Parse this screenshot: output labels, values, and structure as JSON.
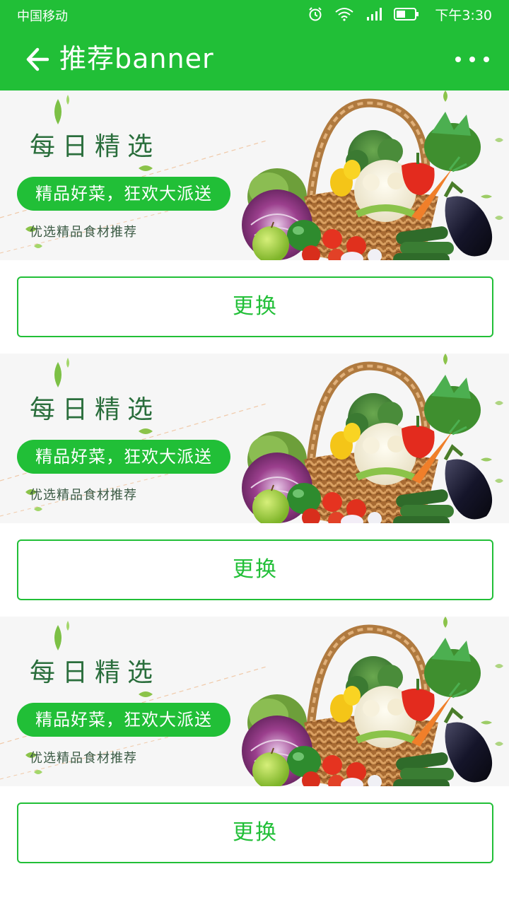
{
  "status_bar": {
    "carrier": "中国移动",
    "time": "下午3:30",
    "icons": [
      "alarm-icon",
      "wifi-icon",
      "signal-icon",
      "battery-icon"
    ]
  },
  "app_bar": {
    "title": "推荐banner",
    "back_icon": "arrow-left-icon",
    "more_icon": "more-horizontal-icon"
  },
  "colors": {
    "brand": "#21bf37",
    "banner_bg": "#f6f6f6",
    "banner_title": "#2a6e3c"
  },
  "banners": [
    {
      "title": "每日精选",
      "pill": "精品好菜，狂欢大派送",
      "subtitle": "优选精品食材推荐",
      "image": "vegetable-basket-image",
      "button": "更换"
    },
    {
      "title": "每日精选",
      "pill": "精品好菜，狂欢大派送",
      "subtitle": "优选精品食材推荐",
      "image": "vegetable-basket-image",
      "button": "更换"
    },
    {
      "title": "每日精选",
      "pill": "精品好菜，狂欢大派送",
      "subtitle": "优选精品食材推荐",
      "image": "vegetable-basket-image",
      "button": "更换"
    }
  ]
}
